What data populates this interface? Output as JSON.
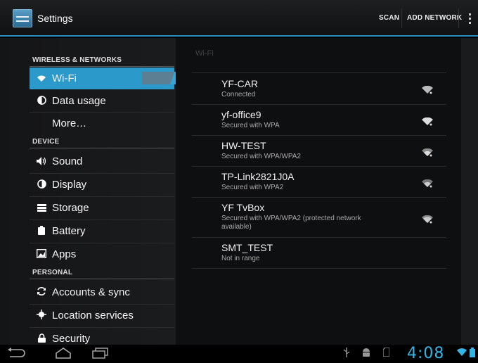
{
  "actionbar": {
    "title": "Settings",
    "scan_label": "SCAN",
    "add_network_label": "ADD NETWORK"
  },
  "colors": {
    "accent": "#33b5e5",
    "selected": "#2b99ca"
  },
  "sidebar": {
    "wireless_header": "WIRELESS & NETWORKS",
    "device_header": "DEVICE",
    "personal_header": "PERSONAL",
    "items": [
      {
        "label": "Wi-Fi",
        "icon": "wifi-icon",
        "toggle": "ON",
        "selected": true
      },
      {
        "label": "Data usage",
        "icon": "data-usage-icon"
      },
      {
        "label": "More…",
        "icon": ""
      },
      {
        "label": "Sound",
        "icon": "speaker-icon"
      },
      {
        "label": "Display",
        "icon": "display-icon"
      },
      {
        "label": "Storage",
        "icon": "storage-icon"
      },
      {
        "label": "Battery",
        "icon": "battery-icon"
      },
      {
        "label": "Apps",
        "icon": "apps-icon"
      },
      {
        "label": "Accounts & sync",
        "icon": "sync-icon"
      },
      {
        "label": "Location services",
        "icon": "location-icon"
      },
      {
        "label": "Security",
        "icon": "lock-icon"
      }
    ]
  },
  "wifi": {
    "section_title": "Wi-Fi",
    "networks": [
      {
        "ssid": "YF-CAR",
        "status": "Connected",
        "signal": true
      },
      {
        "ssid": "yf-office9",
        "status": "Secured with WPA",
        "signal": true
      },
      {
        "ssid": "HW-TEST",
        "status": "Secured with WPA/WPA2",
        "signal": true
      },
      {
        "ssid": "TP-Link2821J0A",
        "status": "Secured with WPA2",
        "signal": true
      },
      {
        "ssid": "YF TvBox",
        "status": "Secured with WPA/WPA2 (protected network available)",
        "signal": true
      },
      {
        "ssid": "SMT_TEST",
        "status": "Not in range",
        "signal": false
      }
    ]
  },
  "statusbar": {
    "clock": "4:08"
  }
}
